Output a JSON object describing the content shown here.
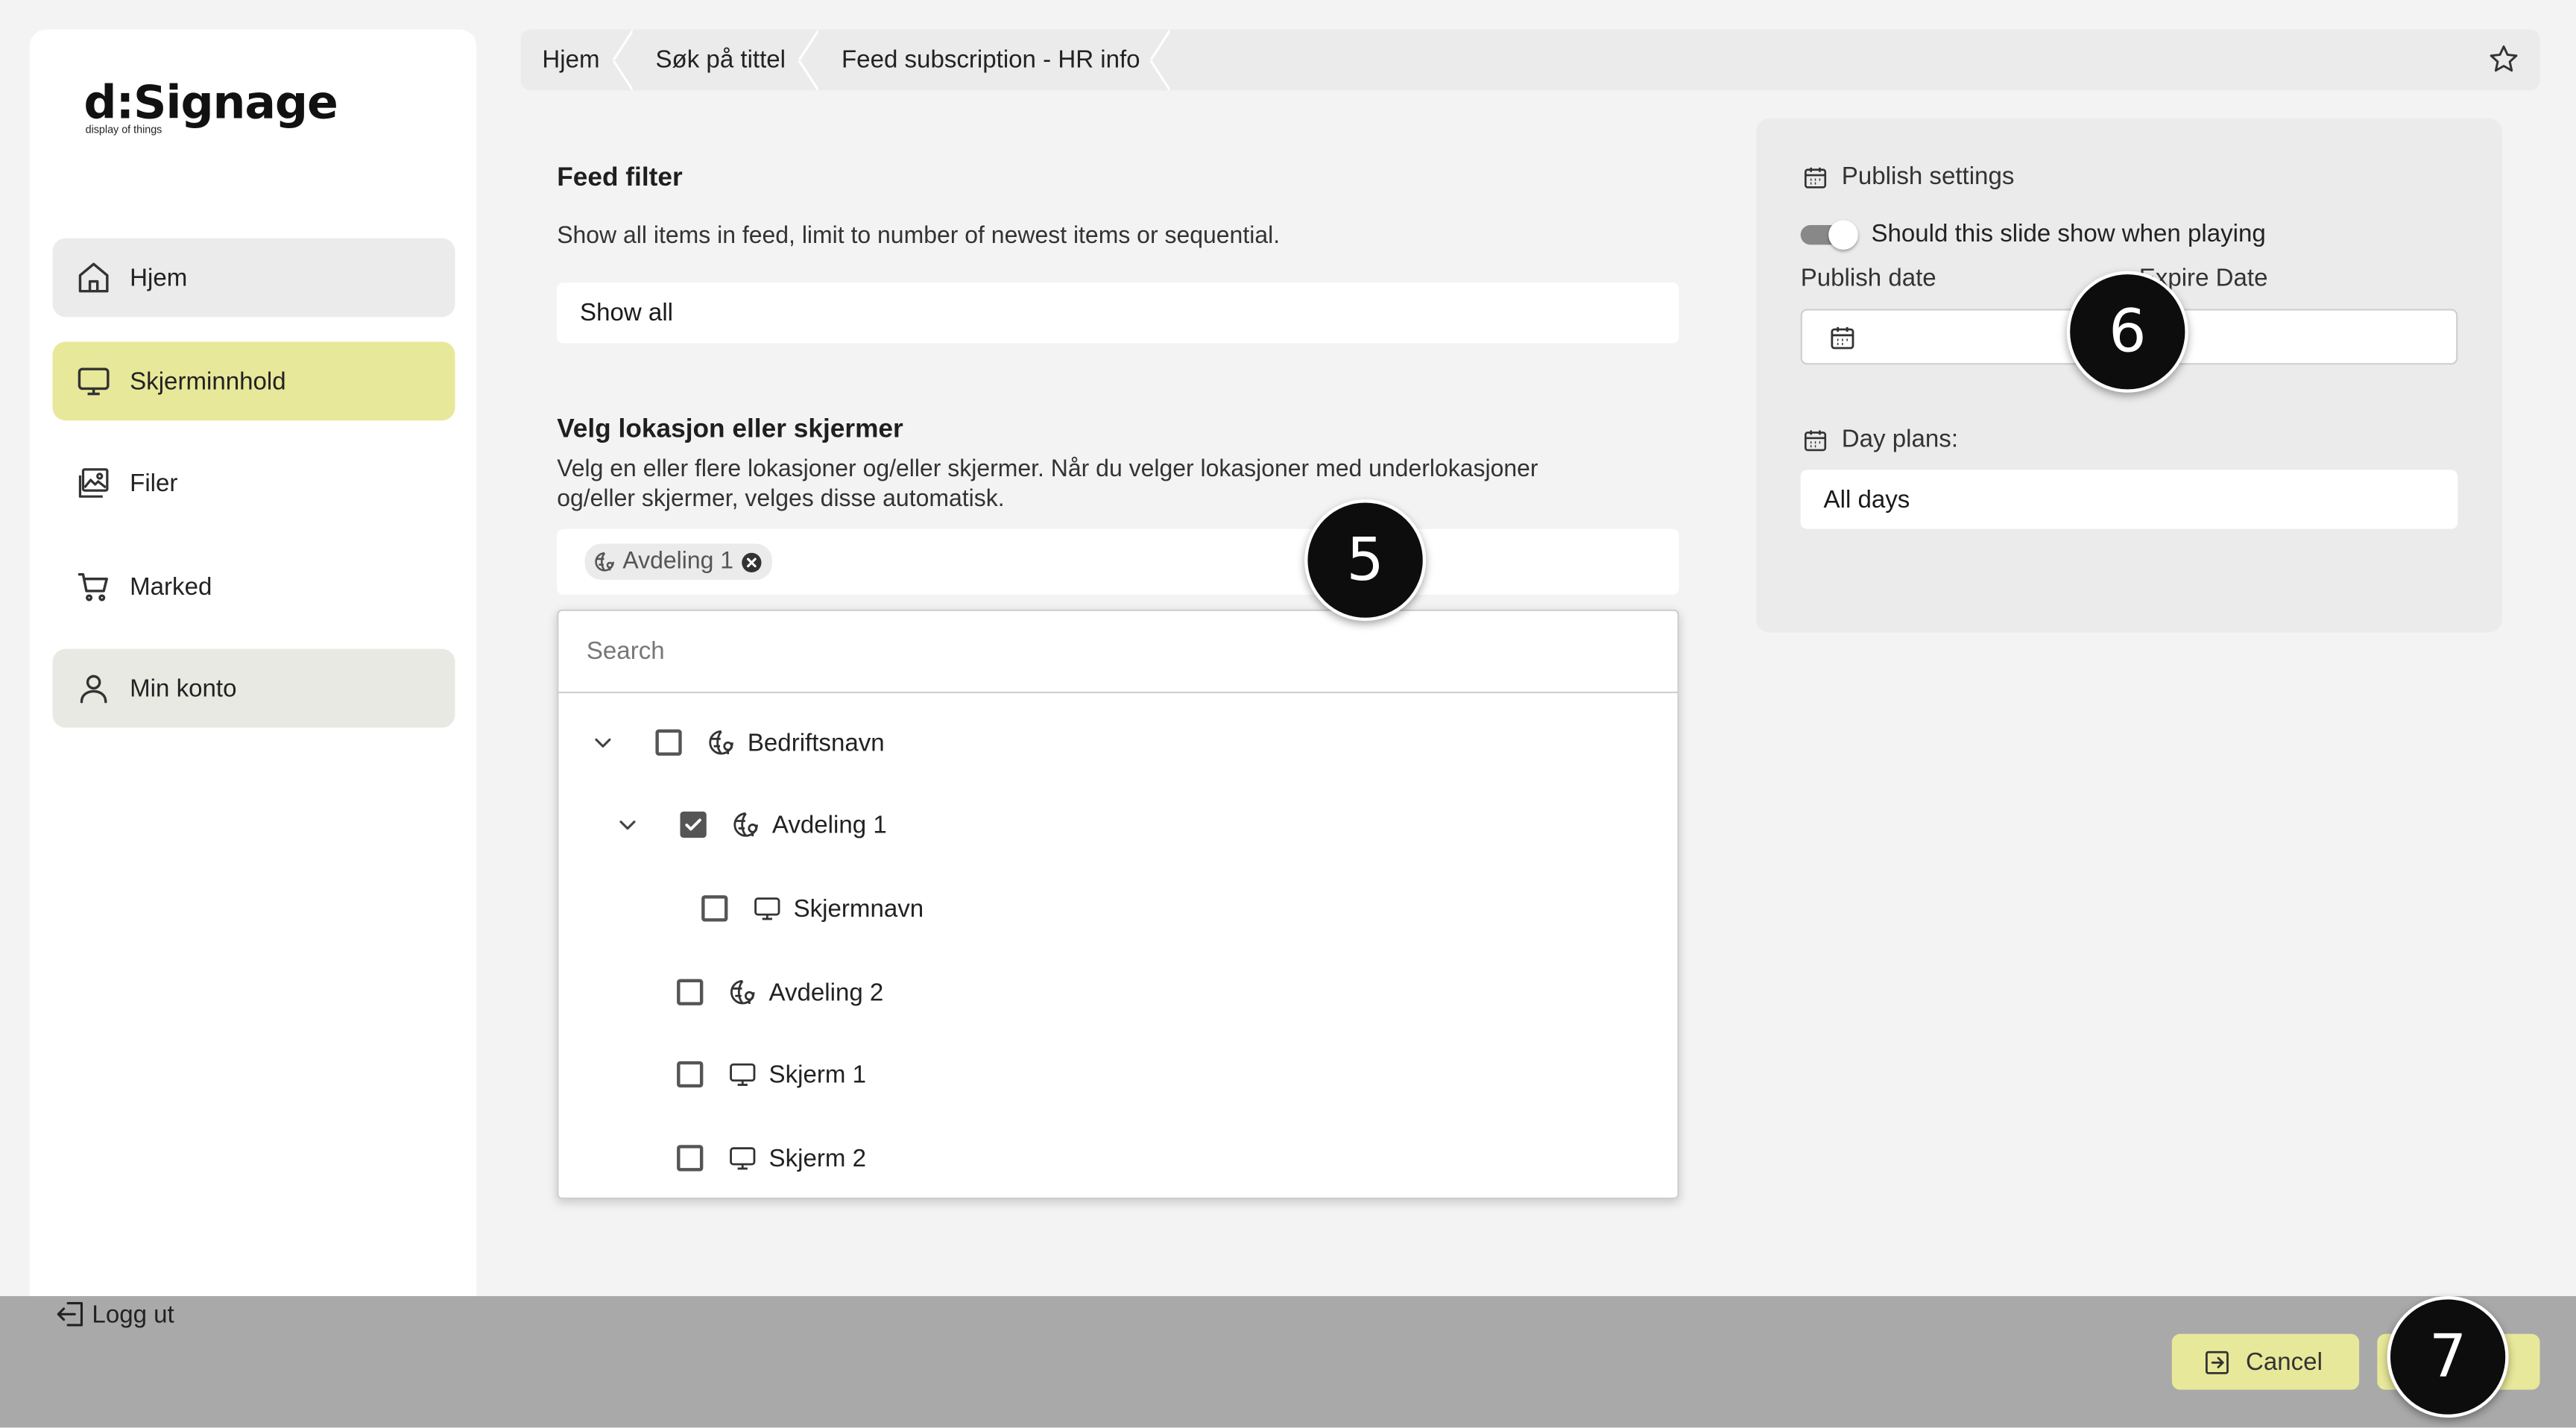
{
  "app": {
    "logo_text": "d:Signage",
    "logo_tagline": "display of things"
  },
  "sidebar": {
    "items": [
      {
        "label": "Hjem",
        "icon": "home-icon"
      },
      {
        "label": "Skjerminnhold",
        "icon": "monitor-icon",
        "active": true
      },
      {
        "label": "Filer",
        "icon": "image-icon"
      },
      {
        "label": "Marked",
        "icon": "cart-icon"
      },
      {
        "label": "Min konto",
        "icon": "user-icon"
      }
    ],
    "logout_label": "Logg ut"
  },
  "breadcrumb": [
    "Hjem",
    "Søk på tittel",
    "Feed subscription - HR info"
  ],
  "feed_filter": {
    "title": "Feed filter",
    "description": "Show all items in feed, limit to number of newest items or sequential.",
    "selected": "Show all"
  },
  "location": {
    "title": "Velg lokasjon eller skjermer",
    "description_line1": "Velg en eller flere lokasjoner og/eller skjermer. Når du velger lokasjoner med underlokasjoner",
    "description_line2": "og/eller skjermer, velges disse automatisk.",
    "selected_chip": "Avdeling 1",
    "search_placeholder": "Search",
    "tree": [
      {
        "label": "Bedriftsnavn",
        "type": "location",
        "checked": false,
        "expanded": true
      },
      {
        "label": "Avdeling 1",
        "type": "location",
        "checked": true,
        "expanded": true
      },
      {
        "label": "Skjermnavn",
        "type": "screen",
        "checked": false
      },
      {
        "label": "Avdeling 2",
        "type": "location",
        "checked": false
      },
      {
        "label": "Skjerm 1",
        "type": "screen",
        "checked": false
      },
      {
        "label": "Skjerm 2",
        "type": "screen",
        "checked": false
      }
    ]
  },
  "publish": {
    "title": "Publish settings",
    "toggle_label": "Should this slide show when playing",
    "toggle_on": true,
    "publish_date_label": "Publish date",
    "expire_date_label": "Expire Date",
    "day_plans_label": "Day plans:",
    "day_plans_value": "All days"
  },
  "footer": {
    "cancel_label": "Cancel"
  },
  "markers": [
    "5",
    "6",
    "7"
  ],
  "colors": {
    "accent": "#e8e89a",
    "background": "#f3f3f3",
    "panel": "#ebebeb",
    "overlay": "#a9a9a9",
    "marker": "#0d0d0d"
  }
}
